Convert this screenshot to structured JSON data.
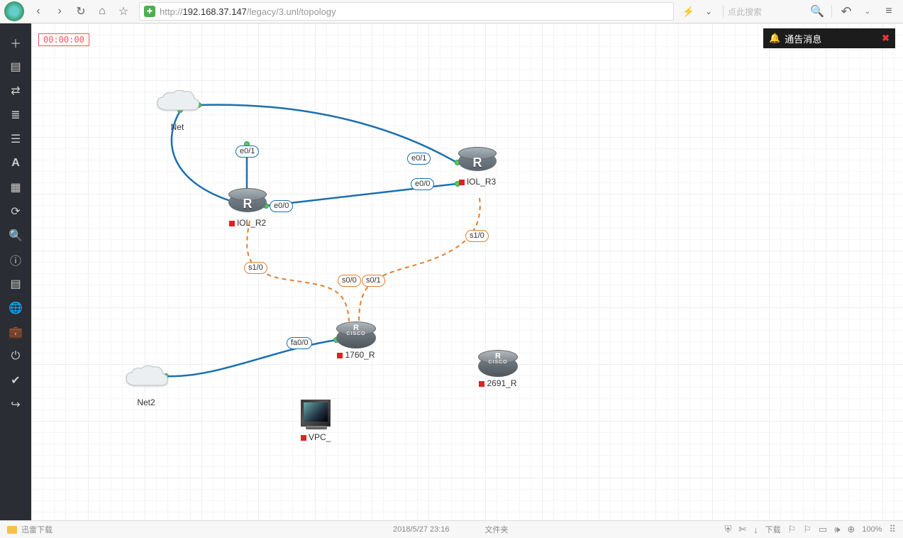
{
  "browser": {
    "url_proto": "http://",
    "url_host": "192.168.37.147",
    "url_path": "/legacy/3.unl/topology",
    "search_placeholder": "点此搜索",
    "zoom": "100%",
    "download_label": "下载"
  },
  "timer": "00:00:00",
  "notice": {
    "title": "通告消息"
  },
  "sidebar_icons": [
    "add",
    "storage",
    "swap",
    "speed-list",
    "list",
    "text",
    "grid",
    "refresh",
    "zoom",
    "info",
    "code",
    "globe",
    "briefcase",
    "power",
    "check",
    "exit"
  ],
  "nodes": {
    "net": {
      "label": "Net"
    },
    "net2": {
      "label": "Net2"
    },
    "iol_r2": {
      "label": "IOL_R2"
    },
    "iol_r3": {
      "label": "IOL_R3"
    },
    "r1760": {
      "label": "1760_R"
    },
    "r2691": {
      "label": "2691_R"
    },
    "vpc": {
      "label": "VPC_"
    }
  },
  "if_labels": {
    "e01_r2": "e0/1",
    "e00_r2": "e0/0",
    "e01_r3": "e0/1",
    "e00_r3": "e0/0",
    "s10_r2": "s1/0",
    "s10_r3": "s1/0",
    "s00": "s0/0",
    "s01": "s0/1",
    "fa00": "fa0/0"
  },
  "status": {
    "left_text": "迅雷下载",
    "date": "2018/5/27 23:16",
    "folder": "文件夹"
  }
}
